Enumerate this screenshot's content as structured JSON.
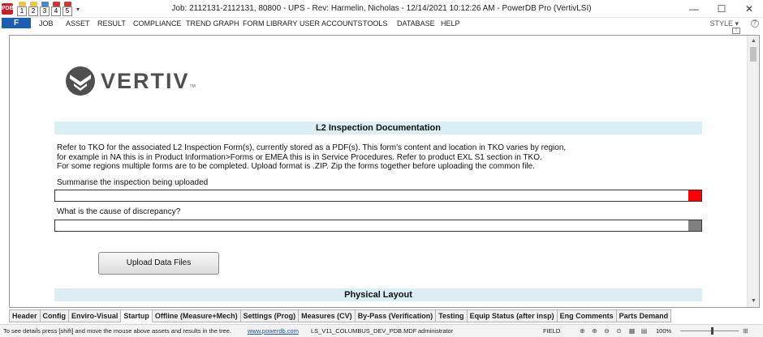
{
  "window": {
    "title": "Job: 2112131-2112131, 80800 - UPS - Rev: Harmelin, Nicholas - 12/14/2021 10:12:26 AM - PowerDB Pro (VertivLSI)",
    "app_icon_label": "PDB",
    "qat_buttons": [
      "1",
      "2",
      "3",
      "4",
      "5"
    ],
    "qat_more": "▾",
    "minimize": "—",
    "maximize": "☐",
    "close": "✕"
  },
  "menu": {
    "file": "F",
    "items": [
      "JOB",
      "ASSET",
      "RESULT",
      "COMPLIANCE",
      "TREND GRAPH",
      "FORM LIBRARY",
      "USER ACCOUNTS",
      "TOOLS",
      "DATABASE",
      "HELP"
    ],
    "style": "STYLE ▾",
    "help_icon": "?",
    "pin": "⊤"
  },
  "form": {
    "logo_text": "VERTIV",
    "logo_tm": "TM",
    "section1_title": "L2 Inspection Documentation",
    "paragraph": [
      "Refer to TKO for the associated L2 Inspection Form(s), currently stored as a PDF(s). This form's content and location in TKO varies by region,",
      "for example in NA this is in Product Information>Forms or EMEA this is in Service Procedures. Refer to product EXL S1 section in TKO.",
      "For some regions multiple forms are to be completed. Upload format is .ZIP. Zip the forms together before uploading the common file."
    ],
    "summary_label": "Summarise the inspection being uploaded",
    "summary_value": "",
    "discrepancy_label": "What is the cause of discrepancy?",
    "discrepancy_value": "",
    "upload_button": "Upload Data Files",
    "section2_title": "Physical Layout"
  },
  "tabs": [
    "Header",
    "Config",
    "Enviro-Visual",
    "Startup",
    "Offline (Measure+Mech)",
    "Settings (Prog)",
    "Measures (CV)",
    "By-Pass (Verification)",
    "Testing",
    "Equip Status (after insp)",
    "Eng Comments",
    "Parts Demand"
  ],
  "active_tab": "Startup",
  "status": {
    "hint": "To see details press [shift] and move the mouse above assets and results in the tree.",
    "link": "www.powerdb.com",
    "database": "LS_V11_COLUMBUS_DEV_PDB.MDF",
    "user": "administrator",
    "mode": "FIELD",
    "zoom": "100%"
  },
  "colors": {
    "file_button": "#1a5fb4",
    "section_header_bg": "#daeef3",
    "required_flag": "#ff0000",
    "optional_flag": "#808080",
    "logo_gray": "#4f4f4f"
  }
}
